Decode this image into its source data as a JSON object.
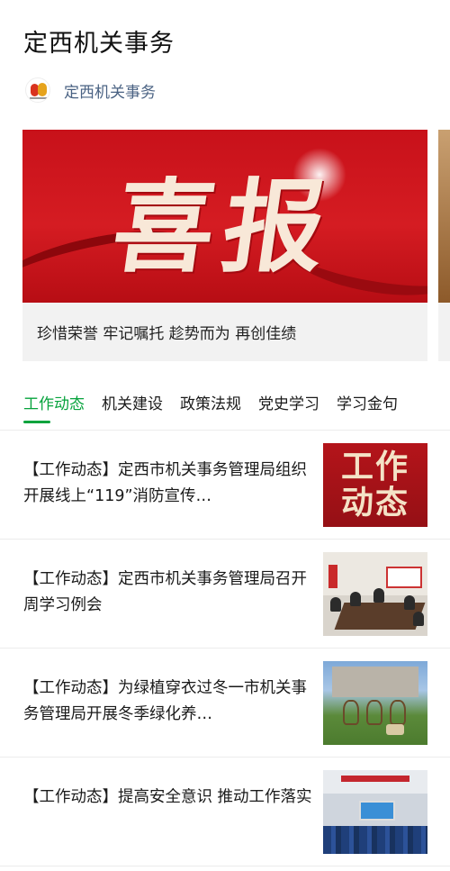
{
  "header": {
    "title": "定西机关事务"
  },
  "account": {
    "logo_icon": "account-logo-icon",
    "name": "定西机关事务"
  },
  "carousel": {
    "banner_text": "喜报",
    "caption": "珍惜荣誉 牢记嘱托 趁势而为 再创佳绩"
  },
  "tabs": [
    {
      "label": "工作动态",
      "active": true
    },
    {
      "label": "机关建设",
      "active": false
    },
    {
      "label": "政策法规",
      "active": false
    },
    {
      "label": "党史学习",
      "active": false
    },
    {
      "label": "学习金句",
      "active": false
    }
  ],
  "colors": {
    "accent": "#07a33d",
    "account_name": "#4a6283",
    "banner_red": "#c8111a"
  },
  "articles": [
    {
      "title": "【工作动态】定西市机关事务管理局组织开展线上“119”消防宣传…",
      "thumb_text": [
        "工作",
        "动态"
      ]
    },
    {
      "title": "【工作动态】定西市机关事务管理局召开周学习例会",
      "thumb_text": []
    },
    {
      "title": "【工作动态】为绿植穿衣过冬一市机关事务管理局开展冬季绿化养…",
      "thumb_text": []
    },
    {
      "title": "【工作动态】提高安全意识 推动工作落实",
      "thumb_text": []
    }
  ]
}
